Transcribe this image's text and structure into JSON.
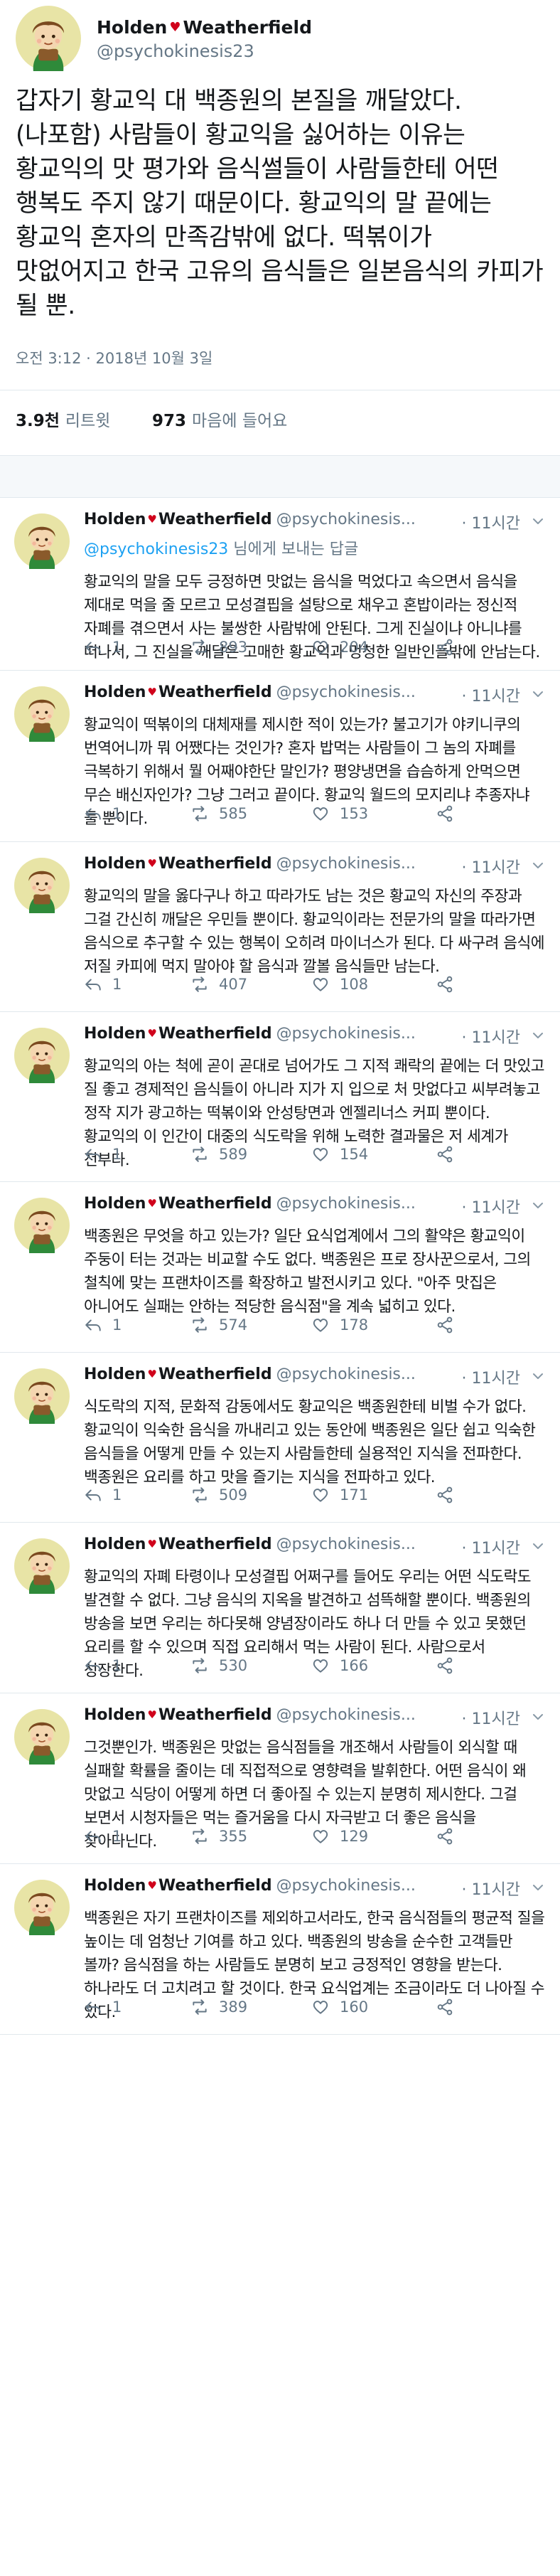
{
  "main_tweet": {
    "display_name_first": "Holden",
    "display_name_second": "Weatherfield",
    "handle": "@psychokinesis23",
    "text": "갑자기 황교익 대 백종원의 본질을 깨달았다. (나포함) 사람들이 황교익을 싫어하는 이유는 황교익의 맛 평가와 음식썰들이 사람들한테 어떤 행복도 주지 않기 때문이다. 황교익의 말 끝에는 황교익 혼자의 만족감밖에 없다. 떡볶이가 맛없어지고 한국 고유의 음식들은 일본음식의 카피가 될 뿐.",
    "timestamp": "오전 3:12 · 2018년 10월 3일",
    "retweets_count": "3.9천",
    "retweets_label": "리트윗",
    "likes_count": "973",
    "likes_label": "마음에 들어요"
  },
  "reply_context": {
    "mention": "@psychokinesis23",
    "suffix": " 님에게 보내는 답글"
  },
  "replies": [
    {
      "name_first": "Holden",
      "name_second": "Weatherfield",
      "handle": "@psychokinesis...",
      "time": "11시간",
      "text": "황교익의 말을 모두 긍정하면 맛없는 음식을 먹었다고 속으면서 음식을 제대로 먹을 줄 모르고 모성결핍을 설탕으로 채우고 혼밥이라는 정신적 자폐를 겪으면서 사는 불쌍한 사람밖에 안된다. 그게 진실이냐 아니냐를 떠나서, 그 진실을 깨달은 고매한 황교익과 멍청한 일반인들밖에 안남는다.",
      "replies": "1",
      "retweets": "893",
      "likes": "204"
    },
    {
      "name_first": "Holden",
      "name_second": "Weatherfield",
      "handle": "@psychokinesis...",
      "time": "11시간",
      "text": "황교익이 떡볶이의 대체재를 제시한 적이 있는가? 불고기가 야키니쿠의 번역어니까 뭐 어쨌다는 것인가? 혼자 밥먹는 사람들이 그 놈의 자폐를 극복하기 위해서 뭘 어째야한단 말인가? 평양냉면을 습슴하게 안먹으면 무슨 배신자인가? 그냥 그러고 끝이다. 황교익 월드의 모지리냐 추종자냐 둘 뿐이다.",
      "replies": "1",
      "retweets": "585",
      "likes": "153"
    },
    {
      "name_first": "Holden",
      "name_second": "Weatherfield",
      "handle": "@psychokinesis...",
      "time": "11시간",
      "text": "황교익의 말을 옳다구나 하고 따라가도 남는 것은 황교익 자신의 주장과 그걸 간신히 깨달은 우민들 뿐이다. 황교익이라는 전문가의 말을 따라가면 음식으로 추구할 수 있는 행복이 오히려 마이너스가 된다. 다 싸구려 음식에 저질 카피에 먹지 말아야 할 음식과 깔볼 음식들만 남는다.",
      "replies": "1",
      "retweets": "407",
      "likes": "108"
    },
    {
      "name_first": "Holden",
      "name_second": "Weatherfield",
      "handle": "@psychokinesis...",
      "time": "11시간",
      "text": "황교익의 아는 척에 곧이 곧대로 넘어가도 그 지적 쾌락의 끝에는 더 맛있고 질 좋고 경제적인 음식들이 아니라 지가 지 입으로 처 맛없다고 씨부려놓고 정작 지가 광고하는 떡볶이와 안성탕면과 엔젤리너스 커피 뿐이다. 황교익의 이 인간이 대중의 식도락을 위해 노력한 결과물은 저 세계가 전부다.",
      "replies": "1",
      "retweets": "589",
      "likes": "154"
    },
    {
      "name_first": "Holden",
      "name_second": "Weatherfield",
      "handle": "@psychokinesis...",
      "time": "11시간",
      "text": "백종원은 무엇을 하고 있는가? 일단 요식업계에서 그의 활약은 황교익이 주둥이 터는 것과는 비교할 수도 없다. 백종원은 프로 장사꾼으로서, 그의 철칙에 맞는 프랜차이즈를 확장하고 발전시키고 있다. \"아주 맛집은 아니어도 실패는 안하는 적당한 음식점\"을 계속 넓히고 있다.",
      "replies": "1",
      "retweets": "574",
      "likes": "178"
    },
    {
      "name_first": "Holden",
      "name_second": "Weatherfield",
      "handle": "@psychokinesis...",
      "time": "11시간",
      "text": "식도락의 지적, 문화적 감동에서도 황교익은 백종원한테 비벌 수가 없다. 황교익이 익숙한 음식을 까내리고 있는 동안에 백종원은 일단 쉽고 익숙한 음식들을 어떻게 만들 수 있는지 사람들한테 실용적인 지식을 전파한다. 백종원은 요리를 하고 맛을 즐기는 지식을 전파하고 있다.",
      "replies": "1",
      "retweets": "509",
      "likes": "171"
    },
    {
      "name_first": "Holden",
      "name_second": "Weatherfield",
      "handle": "@psychokinesis...",
      "time": "11시간",
      "text": "황교익의 자폐 타령이나 모성결핍 어쩌구를 들어도 우리는 어떤 식도락도 발견할 수 없다. 그냥 음식의 지옥을 발견하고 섬뜩해할 뿐이다. 백종원의 방송을 보면 우리는 하다못해 양념장이라도 하나 더 만들 수 있고 못했던 요리를 할 수 있으며 직접 요리해서 먹는 사람이 된다. 사람으로서 성장한다.",
      "replies": "1",
      "retweets": "530",
      "likes": "166"
    },
    {
      "name_first": "Holden",
      "name_second": "Weatherfield",
      "handle": "@psychokinesis...",
      "time": "11시간",
      "text": "그것뿐인가. 백종원은 맛없는 음식점들을 개조해서 사람들이 외식할 때 실패할 확률을 줄이는 데 직접적으로 영향력을 발휘한다. 어떤 음식이 왜 맛없고 식당이 어떻게 하면 더 좋아질 수 있는지 분명히 제시한다. 그걸 보면서 시청자들은 먹는 즐거움을 다시 자극받고 더 좋은 음식을 찾아다닌다.",
      "replies": "1",
      "retweets": "355",
      "likes": "129"
    },
    {
      "name_first": "Holden",
      "name_second": "Weatherfield",
      "handle": "@psychokinesis...",
      "time": "11시간",
      "text": "백종원은 자기 프랜차이즈를 제외하고서라도, 한국 음식점들의 평균적 질을 높이는 데 엄청난 기여를 하고 있다. 백종원의 방송을 순수한 고객들만 볼까? 음식점을 하는 사람들도 분명히 보고 긍정적인 영향을 받는다. 하나라도 더 고치려고 할 것이다. 한국 요식업계는 조금이라도 더 나아질 수 있다.",
      "replies": "1",
      "retweets": "389",
      "likes": "160"
    }
  ],
  "colors": {
    "text": "#14171a",
    "secondary": "#657786",
    "link": "#1da1f2",
    "divider": "#e1e8ed",
    "heart_badge": "#d0021b",
    "avatar_bg": "#e8e4a6"
  },
  "icons": {
    "badge": "heart-badge-icon",
    "reply": "reply-icon",
    "retweet": "retweet-icon",
    "like": "like-icon",
    "share": "share-icon",
    "caret": "chevron-down-icon"
  }
}
